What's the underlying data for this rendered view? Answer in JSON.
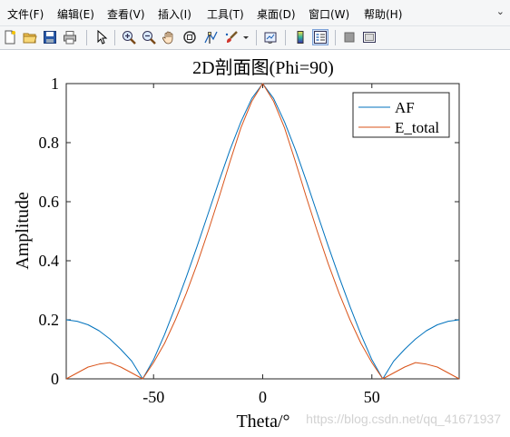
{
  "menubar": {
    "items": [
      "文件(F)",
      "编辑(E)",
      "查看(V)",
      "插入(I)",
      "工具(T)",
      "桌面(D)",
      "窗口(W)",
      "帮助(H)"
    ],
    "overflow": "⌄"
  },
  "toolbar": {
    "buttons": [
      "new-figure-icon",
      "open-file-icon",
      "save-icon",
      "print-icon",
      "edit-plot-arrow-icon",
      "zoom-in-icon",
      "zoom-out-icon",
      "pan-hand-icon",
      "rotate-3d-icon",
      "data-cursor-icon",
      "brush-icon",
      "brush-dropdown-icon",
      "link-plot-icon",
      "colorbar-icon",
      "legend-icon",
      "hide-plot-tools-icon",
      "show-plot-tools-icon"
    ]
  },
  "chart_data": {
    "type": "line",
    "title": "2D剖面图(Phi=90)",
    "xlabel": "Theta/°",
    "ylabel": "Amplitude",
    "xlim": [
      -90,
      90
    ],
    "ylim": [
      0,
      1
    ],
    "xticks": [
      "-50",
      "0",
      "50"
    ],
    "xtick_values": [
      -50,
      0,
      50
    ],
    "yticks": [
      "0",
      "0.2",
      "0.4",
      "0.6",
      "0.8",
      "1"
    ],
    "ytick_values": [
      0,
      0.2,
      0.4,
      0.6,
      0.8,
      1
    ],
    "legend_position": "top-right",
    "colors": {
      "AF": "#0072BD",
      "E_total": "#D95319"
    },
    "series": [
      {
        "name": "AF",
        "x": [
          -90,
          -85,
          -80,
          -75,
          -70,
          -65,
          -60,
          -55,
          -50,
          -45,
          -40,
          -35,
          -30,
          -25,
          -20,
          -15,
          -10,
          -5,
          0,
          5,
          10,
          15,
          20,
          25,
          30,
          35,
          40,
          45,
          50,
          55,
          60,
          65,
          70,
          75,
          80,
          85,
          90
        ],
        "values": [
          0.2,
          0.195,
          0.183,
          0.163,
          0.135,
          0.1,
          0.06,
          0.0,
          0.065,
          0.15,
          0.245,
          0.345,
          0.45,
          0.56,
          0.67,
          0.775,
          0.87,
          0.95,
          1.0,
          0.95,
          0.87,
          0.775,
          0.67,
          0.56,
          0.45,
          0.345,
          0.245,
          0.15,
          0.065,
          0.0,
          0.06,
          0.1,
          0.135,
          0.163,
          0.183,
          0.195,
          0.2
        ]
      },
      {
        "name": "E_total",
        "x": [
          -90,
          -85,
          -80,
          -75,
          -70,
          -65,
          -60,
          -55,
          -50,
          -45,
          -40,
          -35,
          -30,
          -25,
          -20,
          -15,
          -10,
          -5,
          0,
          5,
          10,
          15,
          20,
          25,
          30,
          35,
          40,
          45,
          50,
          55,
          60,
          65,
          70,
          75,
          80,
          85,
          90
        ],
        "values": [
          0.0,
          0.02,
          0.04,
          0.05,
          0.055,
          0.04,
          0.02,
          0.0,
          0.055,
          0.12,
          0.2,
          0.29,
          0.39,
          0.5,
          0.615,
          0.735,
          0.85,
          0.94,
          1.0,
          0.94,
          0.85,
          0.735,
          0.615,
          0.5,
          0.39,
          0.29,
          0.2,
          0.12,
          0.055,
          0.0,
          0.02,
          0.04,
          0.055,
          0.05,
          0.04,
          0.02,
          0.0
        ]
      }
    ]
  },
  "watermark": "https://blog.csdn.net/qq_41671937"
}
